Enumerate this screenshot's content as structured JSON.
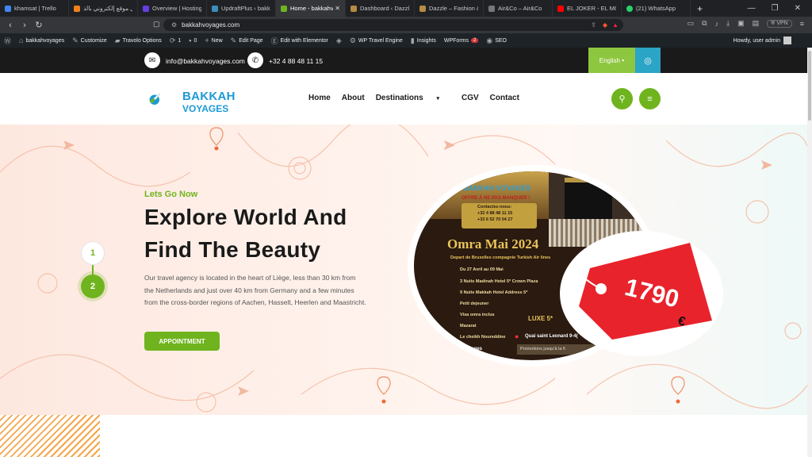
{
  "browser": {
    "tabs": [
      {
        "label": "khamsat | Trello",
        "color": "#4285f4"
      },
      {
        "label": "عمل موقع إلكتروني بالذ",
        "color": "#f07f1e"
      },
      {
        "label": "Overview | Hostinger",
        "color": "#673de6"
      },
      {
        "label": "UpdraftPlus ‹ bakkahv",
        "color": "#3c8dbc"
      },
      {
        "label": "Home - bakkahv",
        "color": "#6fb41e"
      },
      {
        "label": "Dashboard ‹ Dazzle –",
        "color": "#b58b45"
      },
      {
        "label": "Dazzle – Fashion & Jew",
        "color": "#b58b45"
      },
      {
        "label": "Air&Co – Air&Co",
        "color": "#777777"
      },
      {
        "label": "EL JOKER - EL MORAG",
        "color": "#ff0000"
      },
      {
        "label": "(21) WhatsApp",
        "color": "#25d366"
      }
    ],
    "active_tab_index": 4,
    "url": "bakkahvoyages.com",
    "vpn_label": "VPN"
  },
  "wp_admin_bar": {
    "items": [
      "bakkahvoyages",
      "Customize",
      "Travolo Options",
      "1",
      "0",
      "New",
      "Edit Page",
      "Edit with Elementor",
      "",
      "WP Travel Engine",
      "Insights",
      "WPForms",
      "SEO"
    ],
    "wpforms_badge": "2",
    "howdy": "Howdy, user admin"
  },
  "topbar": {
    "email": "info@bakkahvoyages.com",
    "phone": "+32 4 88 48 11 15",
    "language": "English"
  },
  "header": {
    "brand_line1": "BAKKAH",
    "brand_line2": "VOYAGES",
    "menu": [
      "Home",
      "About",
      "Destinations",
      "CGV",
      "Contact"
    ]
  },
  "hero": {
    "kicker": "Lets Go Now",
    "title_line1": "Explore World And",
    "title_line2": "Find The Beauty",
    "description": "Our travel agency is located in the heart of Liège, less than 30 km from the Netherlands and just over 40 km from Germany and a few minutes from the cross-border regions of Aachen, Hasselt, Heerlen and Maastricht.",
    "cta": "APPOINTMENT",
    "slides": [
      "1",
      "2"
    ],
    "active_slide": "2"
  },
  "poster": {
    "brand": "BAKKAH VOYAGES",
    "offer": "OFFRE À NE PAS MANQUER !",
    "contact_title": "Contactez-nous:",
    "phone1": "+32 4 88 48 11 15",
    "phone2": "+33 6 52 70 04 27",
    "title": "Omra Mai 2024",
    "departure": "Depart de Bruxelles compagnie Turkish Air lines",
    "features": [
      "Du 27 Avril au 09 Mai",
      "3 Nuits Madinah Hotel 5* Crown Plaza",
      "9 Nuits Makkah Hotel Address 5*",
      "Petit dejeuner",
      "Visa omra inclus",
      "Mazarat",
      "Le cheikh Noureddine"
    ],
    "luxe": "LUXE 5*",
    "address": "Quai saint Leonard 9-4(",
    "promo": "Promotions jusqu'à la fi",
    "footer_brand": "voyages",
    "price": "1790",
    "currency": "€"
  }
}
